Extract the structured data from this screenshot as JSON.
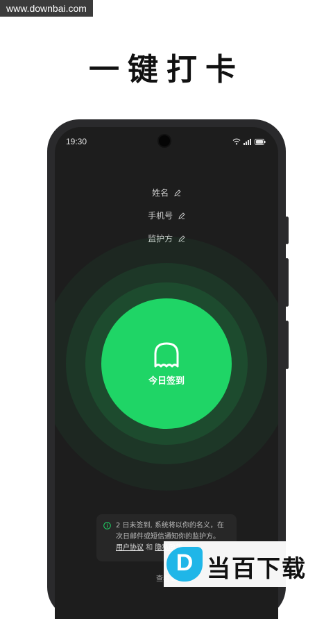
{
  "watermark": "www.downbai.com",
  "headline": "一键打卡",
  "status_bar": {
    "time": "19:30",
    "icons": [
      "wifi-icon",
      "signal-icon",
      "battery-icon"
    ]
  },
  "form": {
    "name_label": "姓名",
    "phone_label": "手机号",
    "guardian_label": "监护方"
  },
  "checkin": {
    "label": "今日签到",
    "icon": "ghost-icon",
    "color": "#1fd566"
  },
  "notice": {
    "text_line1": "2 日未签到, 系统将以你的名义，在",
    "text_line2": "次日邮件或短信通知你的监护方。",
    "user_agreement": "用户协议",
    "and": "和",
    "privacy_policy": "隐私政策"
  },
  "bottom_link": "查看高",
  "brand": {
    "logo_letter": "D",
    "name": "当百下载"
  }
}
